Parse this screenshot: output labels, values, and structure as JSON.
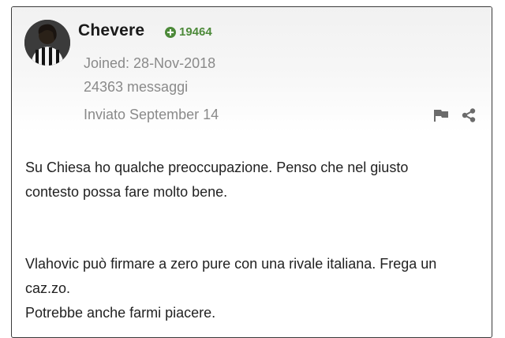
{
  "author": {
    "username": "Chevere",
    "reputation": "19464",
    "joined": "Joined: 28-Nov-2018",
    "messages": "24363 messaggi"
  },
  "post": {
    "posted": "Inviato September 14",
    "paragraphs": [
      [
        "Su Chiesa ho qualche preoccupazione. Penso che nel giusto",
        "contesto possa fare molto bene."
      ],
      [
        "Vlahovic può firmare a zero pure con una rivale italiana. Frega un",
        "caz.zo.",
        "Potrebbe anche farmi piacere."
      ]
    ]
  },
  "icons": {
    "reputation": "plus-circle-icon",
    "report": "flag-icon",
    "share": "share-icon"
  },
  "colors": {
    "reputation": "#4d8a3a",
    "meta_text": "#8a8a8a",
    "header_bg": "#f1f1f1"
  }
}
